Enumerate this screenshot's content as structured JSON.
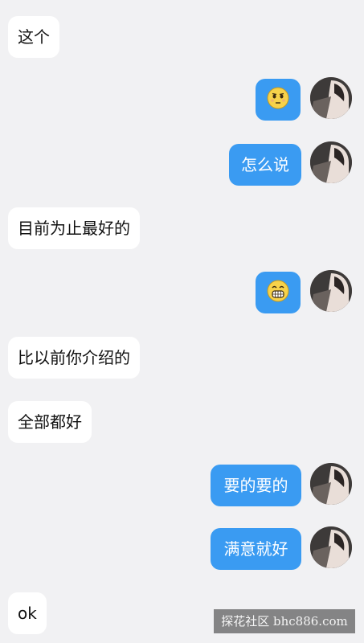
{
  "messages": [
    {
      "side": "in",
      "text": "这个"
    },
    {
      "side": "out",
      "type": "emoji",
      "icon": "neutral-face-emoji"
    },
    {
      "side": "out",
      "text": "怎么说"
    },
    {
      "side": "in",
      "text": "目前为止最好的"
    },
    {
      "side": "out",
      "type": "emoji",
      "icon": "grinning-face-emoji"
    },
    {
      "side": "in",
      "text": "比以前你介绍的"
    },
    {
      "side": "in",
      "text": "全部都好"
    },
    {
      "side": "out",
      "text": "要的要的"
    },
    {
      "side": "out",
      "text": "满意就好"
    },
    {
      "side": "in",
      "text": "ok"
    }
  ],
  "watermark": "探花社区 bhc886.com",
  "colors": {
    "background": "#f1f1f3",
    "incoming_bubble": "#ffffff",
    "outgoing_bubble": "#3a9bf2",
    "emoji_face": "#f7d24a"
  }
}
